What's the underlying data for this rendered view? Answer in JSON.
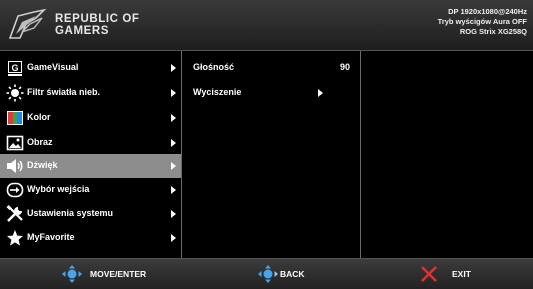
{
  "header": {
    "brand_line1": "REPUBLIC OF",
    "brand_line2": "GAMERS",
    "status_line1": "DP 1920x1080@240Hz",
    "status_line2": "Tryb wyścigów  Aura OFF",
    "status_line3": "ROG Strix XG258Q"
  },
  "menu": {
    "items": [
      {
        "label": "GameVisual",
        "icon": "gamevisual-icon"
      },
      {
        "label": "Filtr światła nieb.",
        "icon": "blue-light-icon"
      },
      {
        "label": "Kolor",
        "icon": "color-icon"
      },
      {
        "label": "Obraz",
        "icon": "image-icon"
      },
      {
        "label": "Dźwięk",
        "icon": "speaker-icon"
      },
      {
        "label": "Wybór wejścia",
        "icon": "input-select-icon"
      },
      {
        "label": "Ustawienia systemu",
        "icon": "tools-icon"
      },
      {
        "label": "MyFavorite",
        "icon": "star-icon"
      }
    ],
    "selected": "Dźwięk"
  },
  "submenu": {
    "items": [
      {
        "label": "Głośność",
        "value": "90"
      },
      {
        "label": "Wyciszenie",
        "value": ""
      }
    ]
  },
  "footer": {
    "move_label": "MOVE/ENTER",
    "back_label": "BACK",
    "exit_label": "EXIT"
  },
  "colors": {
    "selected_bg": "#8d8d8d",
    "joystick_blue": "#4aa3e8",
    "exit_red": "#e03030"
  }
}
